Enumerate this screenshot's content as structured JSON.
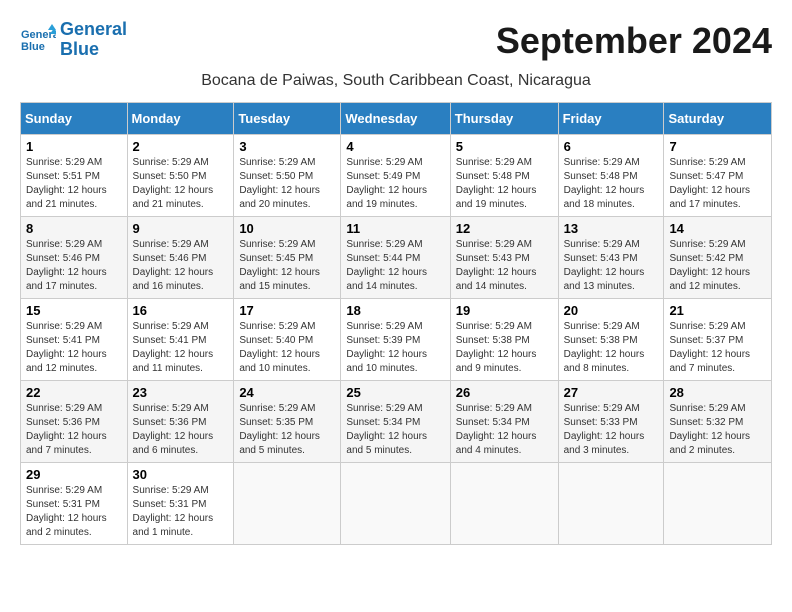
{
  "header": {
    "logo_line1": "General",
    "logo_line2": "Blue",
    "month_year": "September 2024",
    "location": "Bocana de Paiwas, South Caribbean Coast, Nicaragua"
  },
  "weekdays": [
    "Sunday",
    "Monday",
    "Tuesday",
    "Wednesday",
    "Thursday",
    "Friday",
    "Saturday"
  ],
  "weeks": [
    [
      {
        "day": "1",
        "sunrise": "5:29 AM",
        "sunset": "5:51 PM",
        "daylight": "12 hours and 21 minutes."
      },
      {
        "day": "2",
        "sunrise": "5:29 AM",
        "sunset": "5:50 PM",
        "daylight": "12 hours and 21 minutes."
      },
      {
        "day": "3",
        "sunrise": "5:29 AM",
        "sunset": "5:50 PM",
        "daylight": "12 hours and 20 minutes."
      },
      {
        "day": "4",
        "sunrise": "5:29 AM",
        "sunset": "5:49 PM",
        "daylight": "12 hours and 19 minutes."
      },
      {
        "day": "5",
        "sunrise": "5:29 AM",
        "sunset": "5:48 PM",
        "daylight": "12 hours and 19 minutes."
      },
      {
        "day": "6",
        "sunrise": "5:29 AM",
        "sunset": "5:48 PM",
        "daylight": "12 hours and 18 minutes."
      },
      {
        "day": "7",
        "sunrise": "5:29 AM",
        "sunset": "5:47 PM",
        "daylight": "12 hours and 17 minutes."
      }
    ],
    [
      {
        "day": "8",
        "sunrise": "5:29 AM",
        "sunset": "5:46 PM",
        "daylight": "12 hours and 17 minutes."
      },
      {
        "day": "9",
        "sunrise": "5:29 AM",
        "sunset": "5:46 PM",
        "daylight": "12 hours and 16 minutes."
      },
      {
        "day": "10",
        "sunrise": "5:29 AM",
        "sunset": "5:45 PM",
        "daylight": "12 hours and 15 minutes."
      },
      {
        "day": "11",
        "sunrise": "5:29 AM",
        "sunset": "5:44 PM",
        "daylight": "12 hours and 14 minutes."
      },
      {
        "day": "12",
        "sunrise": "5:29 AM",
        "sunset": "5:43 PM",
        "daylight": "12 hours and 14 minutes."
      },
      {
        "day": "13",
        "sunrise": "5:29 AM",
        "sunset": "5:43 PM",
        "daylight": "12 hours and 13 minutes."
      },
      {
        "day": "14",
        "sunrise": "5:29 AM",
        "sunset": "5:42 PM",
        "daylight": "12 hours and 12 minutes."
      }
    ],
    [
      {
        "day": "15",
        "sunrise": "5:29 AM",
        "sunset": "5:41 PM",
        "daylight": "12 hours and 12 minutes."
      },
      {
        "day": "16",
        "sunrise": "5:29 AM",
        "sunset": "5:41 PM",
        "daylight": "12 hours and 11 minutes."
      },
      {
        "day": "17",
        "sunrise": "5:29 AM",
        "sunset": "5:40 PM",
        "daylight": "12 hours and 10 minutes."
      },
      {
        "day": "18",
        "sunrise": "5:29 AM",
        "sunset": "5:39 PM",
        "daylight": "12 hours and 10 minutes."
      },
      {
        "day": "19",
        "sunrise": "5:29 AM",
        "sunset": "5:38 PM",
        "daylight": "12 hours and 9 minutes."
      },
      {
        "day": "20",
        "sunrise": "5:29 AM",
        "sunset": "5:38 PM",
        "daylight": "12 hours and 8 minutes."
      },
      {
        "day": "21",
        "sunrise": "5:29 AM",
        "sunset": "5:37 PM",
        "daylight": "12 hours and 7 minutes."
      }
    ],
    [
      {
        "day": "22",
        "sunrise": "5:29 AM",
        "sunset": "5:36 PM",
        "daylight": "12 hours and 7 minutes."
      },
      {
        "day": "23",
        "sunrise": "5:29 AM",
        "sunset": "5:36 PM",
        "daylight": "12 hours and 6 minutes."
      },
      {
        "day": "24",
        "sunrise": "5:29 AM",
        "sunset": "5:35 PM",
        "daylight": "12 hours and 5 minutes."
      },
      {
        "day": "25",
        "sunrise": "5:29 AM",
        "sunset": "5:34 PM",
        "daylight": "12 hours and 5 minutes."
      },
      {
        "day": "26",
        "sunrise": "5:29 AM",
        "sunset": "5:34 PM",
        "daylight": "12 hours and 4 minutes."
      },
      {
        "day": "27",
        "sunrise": "5:29 AM",
        "sunset": "5:33 PM",
        "daylight": "12 hours and 3 minutes."
      },
      {
        "day": "28",
        "sunrise": "5:29 AM",
        "sunset": "5:32 PM",
        "daylight": "12 hours and 2 minutes."
      }
    ],
    [
      {
        "day": "29",
        "sunrise": "5:29 AM",
        "sunset": "5:31 PM",
        "daylight": "12 hours and 2 minutes."
      },
      {
        "day": "30",
        "sunrise": "5:29 AM",
        "sunset": "5:31 PM",
        "daylight": "12 hours and 1 minute."
      },
      null,
      null,
      null,
      null,
      null
    ]
  ]
}
